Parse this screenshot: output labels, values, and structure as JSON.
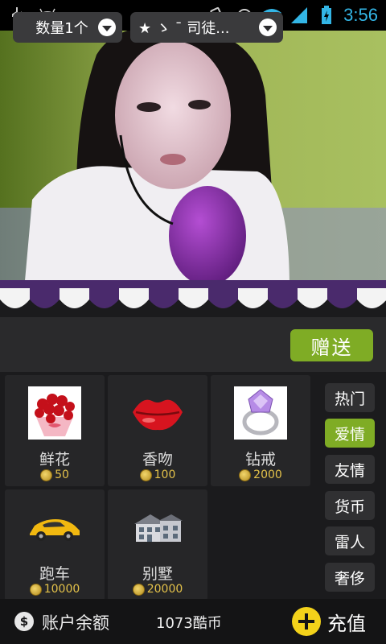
{
  "status_bar": {
    "time": "3:56",
    "icons": [
      "usb-icon",
      "android-icon",
      "vibrate-icon",
      "alarm-icon",
      "wifi-icon",
      "signal-icon",
      "battery-charging-icon"
    ]
  },
  "video": {
    "description_icon": "live-video-stream"
  },
  "controls": {
    "quantity_label": "数量1个",
    "recipient_label": "★ ゝ ¯ 司徒...",
    "send_label": "赠送"
  },
  "gifts": [
    {
      "name": "鲜花",
      "price": "50",
      "icon": "flower-bouquet-icon"
    },
    {
      "name": "香吻",
      "price": "100",
      "icon": "lips-icon"
    },
    {
      "name": "钻戒",
      "price": "2000",
      "icon": "diamond-ring-icon"
    },
    {
      "name": "跑车",
      "price": "10000",
      "icon": "sports-car-icon"
    },
    {
      "name": "别墅",
      "price": "20000",
      "icon": "villa-icon"
    }
  ],
  "categories": [
    {
      "label": "热门",
      "active": false
    },
    {
      "label": "爱情",
      "active": true
    },
    {
      "label": "友情",
      "active": false
    },
    {
      "label": "货币",
      "active": false
    },
    {
      "label": "雷人",
      "active": false
    },
    {
      "label": "奢侈",
      "active": false
    }
  ],
  "bottom": {
    "balance_label": "账户余额",
    "balance_value": "1073酷币",
    "recharge_label": "充值"
  },
  "colors": {
    "accent_green": "#7fac25",
    "coin_gold": "#e4c24a",
    "plus_yellow": "#f3d21a",
    "awning_purple": "#4a2a6c",
    "status_time_blue": "#33b5e5"
  }
}
